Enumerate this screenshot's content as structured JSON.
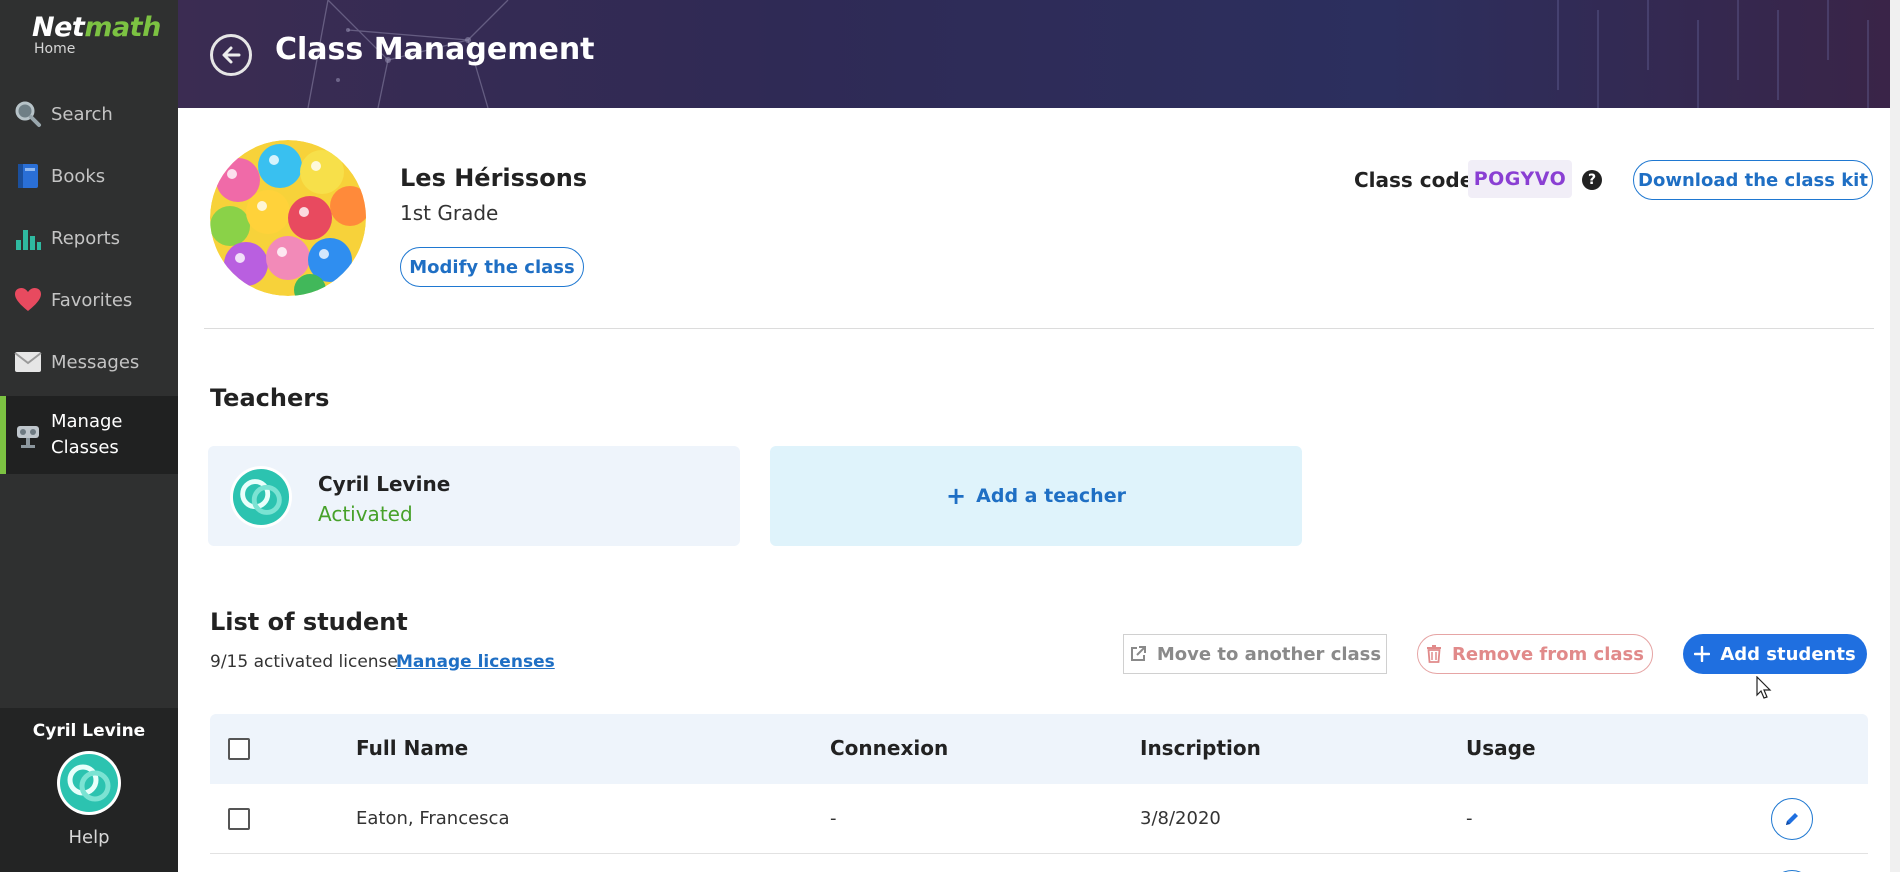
{
  "app": {
    "logo_main": "Net",
    "logo_accent": "math",
    "logo_sub": "Home"
  },
  "sidebar": {
    "items": [
      {
        "label": "Search",
        "icon": "search-icon"
      },
      {
        "label": "Books",
        "icon": "book-icon"
      },
      {
        "label": "Reports",
        "icon": "bar-chart-icon"
      },
      {
        "label": "Favorites",
        "icon": "heart-icon"
      },
      {
        "label": "Messages",
        "icon": "envelope-icon"
      },
      {
        "label": "Manage Classes",
        "label_line1": "Manage",
        "label_line2": "Classes",
        "icon": "trophy-icon",
        "active": true
      }
    ],
    "user_name": "Cyril Levine",
    "help_label": "Help"
  },
  "header": {
    "title": "Class Management"
  },
  "class_info": {
    "name": "Les Hérissons",
    "grade": "1st Grade",
    "modify_label": "Modify the class",
    "code_label": "Class code",
    "code_value": "POGYVO",
    "help_glyph": "?",
    "download_label": "Download the class kit"
  },
  "teachers": {
    "title": "Teachers",
    "list": [
      {
        "name": "Cyril Levine",
        "status": "Activated"
      }
    ],
    "add_label": "Add a teacher"
  },
  "students": {
    "title": "List of student",
    "license_text": "9/15 activated license",
    "manage_licenses_label": "Manage licenses",
    "move_label": "Move to another class",
    "remove_label": "Remove from class",
    "add_label": "Add students",
    "columns": [
      "Full Name",
      "Connexion",
      "Inscription",
      "Usage"
    ],
    "rows": [
      {
        "name": "Eaton, Francesca",
        "connexion": "-",
        "inscription": "3/8/2020",
        "usage": "-"
      }
    ]
  },
  "colors": {
    "accent_green": "#7cc242",
    "primary_blue": "#1f6fe0",
    "code_purple": "#8a3fd3",
    "status_green": "#47a12a",
    "danger_red": "#e18a8a"
  }
}
